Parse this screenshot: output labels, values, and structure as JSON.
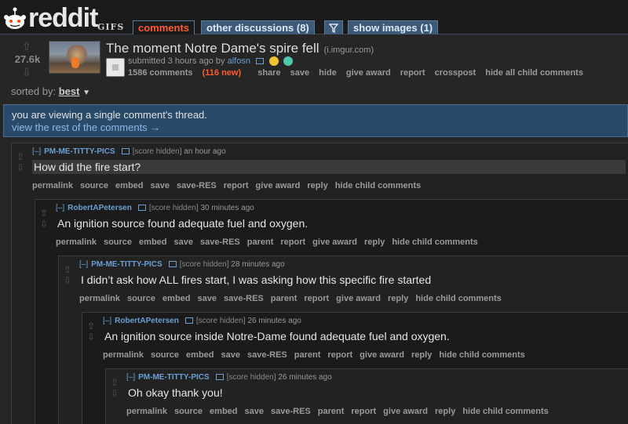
{
  "header": {
    "wordmark": "reddit",
    "subreddit": "GIFS",
    "tabs": [
      {
        "label": "comments",
        "selected": true
      },
      {
        "label": "other discussions (8)",
        "selected": false
      },
      {
        "label": "show images (1)",
        "selected": false
      }
    ],
    "filter_icon": "filter-icon"
  },
  "post": {
    "score": "27.6k",
    "title": "The moment Notre Dame's spire fell",
    "domain": "(i.imgur.com)",
    "submitted": "submitted 3 hours ago by",
    "author": "alfosn",
    "comments_count": "1586 comments",
    "new_count": "(116 new)",
    "actions": [
      "share",
      "save",
      "hide",
      "give award",
      "report",
      "crosspost",
      "hide all child comments"
    ]
  },
  "sort": {
    "label": "sorted by:",
    "value": "best"
  },
  "banner": {
    "line1": "you are viewing a single comment's thread.",
    "line2": "view the rest of the comments →"
  },
  "comments": [
    {
      "toggle": "[–]",
      "author": "PM-ME-TITTY-PICS",
      "score": "[score hidden]",
      "time": "an hour ago",
      "body": "How did the fire start?",
      "actions": [
        "permalink",
        "source",
        "embed",
        "save",
        "save-RES",
        "report",
        "give award",
        "reply",
        "hide child comments"
      ]
    },
    {
      "toggle": "[–]",
      "author": "RobertAPetersen",
      "score": "[score hidden]",
      "time": "30 minutes ago",
      "body": "An ignition source found adequate fuel and oxygen.",
      "actions": [
        "permalink",
        "source",
        "embed",
        "save",
        "save-RES",
        "parent",
        "report",
        "give award",
        "reply",
        "hide child comments"
      ]
    },
    {
      "toggle": "[–]",
      "author": "PM-ME-TITTY-PICS",
      "score": "[score hidden]",
      "time": "28 minutes ago",
      "body": "I didn’t ask how ALL fires start, I was asking how this specific fire started",
      "actions": [
        "permalink",
        "source",
        "embed",
        "save",
        "save-RES",
        "parent",
        "report",
        "give award",
        "reply",
        "hide child comments"
      ]
    },
    {
      "toggle": "[–]",
      "author": "RobertAPetersen",
      "score": "[score hidden]",
      "time": "26 minutes ago",
      "body": "An ignition source inside Notre-Dame found adequate fuel and oxygen.",
      "actions": [
        "permalink",
        "source",
        "embed",
        "save",
        "save-RES",
        "parent",
        "report",
        "give award",
        "reply",
        "hide child comments"
      ]
    },
    {
      "toggle": "[–]",
      "author": "PM-ME-TITTY-PICS",
      "score": "[score hidden]",
      "time": "26 minutes ago",
      "body": "Oh okay thank you!",
      "actions": [
        "permalink",
        "source",
        "embed",
        "save",
        "save-RES",
        "parent",
        "report",
        "give award",
        "reply",
        "hide child comments"
      ]
    }
  ]
}
